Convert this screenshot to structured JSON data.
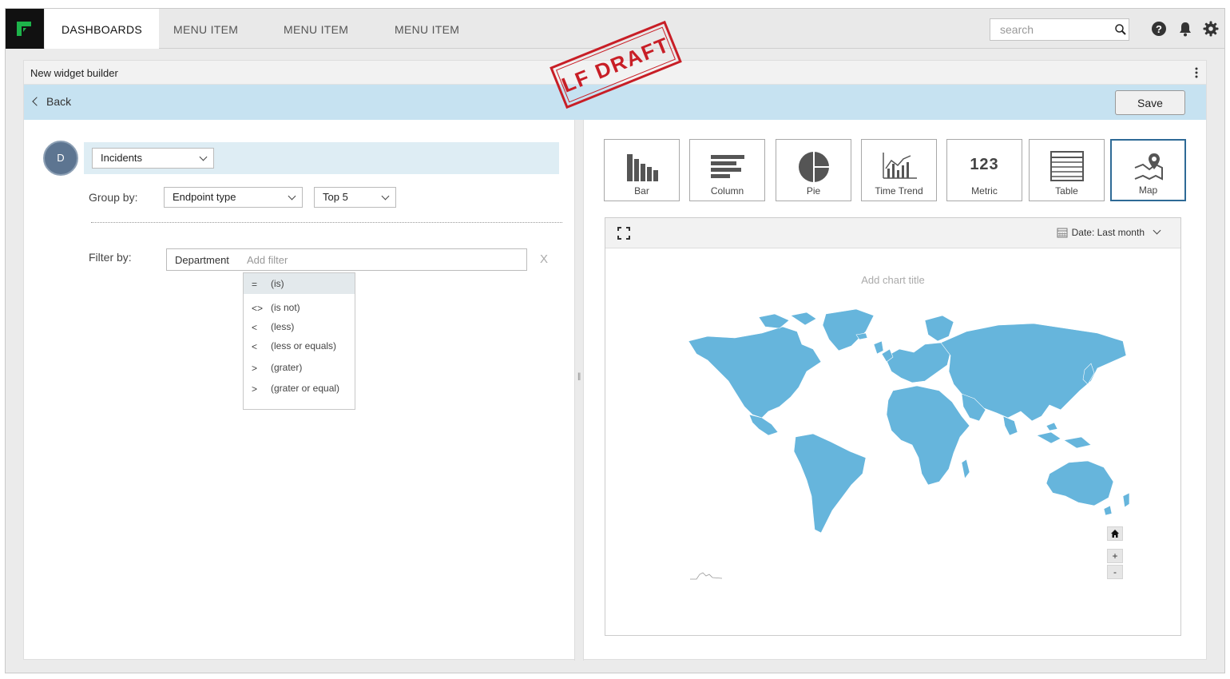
{
  "nav": {
    "tabs": [
      "DASHBOARDS",
      "MENU ITEM",
      "MENU ITEM",
      "MENU ITEM"
    ],
    "search_placeholder": "search"
  },
  "stamp": "LF DRAFT",
  "panel": {
    "title": "New widget builder",
    "back_label": "Back",
    "save_label": "Save"
  },
  "builder": {
    "avatar_initial": "D",
    "datasource": "Incidents",
    "group_by_label": "Group by:",
    "group_by_value": "Endpoint type",
    "top_value": "Top 5",
    "filter_by_label": "Filter by:",
    "filter_field": "Department",
    "filter_placeholder": "Add filter",
    "clear_label": "X",
    "operators": [
      {
        "symbol": "=",
        "label": "(is)"
      },
      {
        "symbol": "<>",
        "label": "(is not)"
      },
      {
        "symbol": "<",
        "label": "(less)"
      },
      {
        "symbol": "<",
        "label": "(less or equals)"
      },
      {
        "symbol": ">",
        "label": "(grater)"
      },
      {
        "symbol": ">",
        "label": "(grater or equal)"
      }
    ],
    "selected_operator_index": 0
  },
  "chart_types": [
    {
      "label": "Bar",
      "icon": "bar-chart-icon"
    },
    {
      "label": "Column",
      "icon": "column-chart-icon"
    },
    {
      "label": "Pie",
      "icon": "pie-chart-icon"
    },
    {
      "label": "Time Trend",
      "icon": "time-trend-icon"
    },
    {
      "label": "Metric",
      "icon": "metric-icon",
      "text": "123"
    },
    {
      "label": "Table",
      "icon": "table-icon"
    },
    {
      "label": "Map",
      "icon": "map-icon"
    }
  ],
  "selected_chart_type": "Map",
  "preview": {
    "date_label": "Date: Last month",
    "chart_title_placeholder": "Add chart title",
    "map_color": "#66b5dc",
    "zoom_in": "+",
    "zoom_out": "-"
  },
  "colors": {
    "accent_selected": "#2e6a96",
    "back_bar": "#c6e2f1",
    "stamp": "#c81e26"
  }
}
